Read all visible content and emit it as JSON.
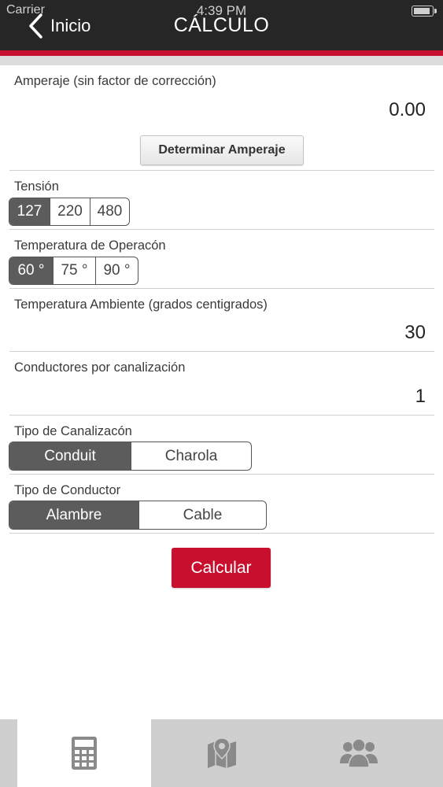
{
  "status_bar": {
    "carrier": "Carrier",
    "time": "4:39 PM"
  },
  "nav": {
    "back_label": "Inicio",
    "title": "CÁLCULO"
  },
  "form": {
    "amperaje": {
      "label": "Amperaje (sin factor de corrección)",
      "value": "0.00",
      "button_label": "Determinar Amperaje"
    },
    "tension": {
      "label": "Tensión",
      "options": [
        "127",
        "220",
        "480"
      ],
      "selected": "127"
    },
    "temperatura_operacion": {
      "label": "Temperatura de Operacón",
      "options": [
        "60 °",
        "75 °",
        "90 °"
      ],
      "selected": "60 °"
    },
    "temperatura_ambiente": {
      "label": "Temperatura Ambiente (grados centigrados)",
      "value": "30"
    },
    "conductores": {
      "label": "Conductores por canalización",
      "value": "1"
    },
    "tipo_canalizacion": {
      "label": "Tipo de Canalizacón",
      "options": [
        "Conduit",
        "Charola"
      ],
      "selected": "Conduit"
    },
    "tipo_conductor": {
      "label": "Tipo de Conductor",
      "options": [
        "Alambre",
        "Cable"
      ],
      "selected": "Alambre"
    },
    "calcular_label": "Calcular"
  },
  "tabbar": {
    "tabs": [
      {
        "icon": "calculator-icon",
        "active": true
      },
      {
        "icon": "map-pin-icon",
        "active": false
      },
      {
        "icon": "users-group-icon",
        "active": false
      }
    ]
  },
  "colors": {
    "accent": "#c8102e",
    "header": "#262626",
    "selected_segment": "#5c5c5c",
    "tabbar": "#cfcfcf"
  }
}
